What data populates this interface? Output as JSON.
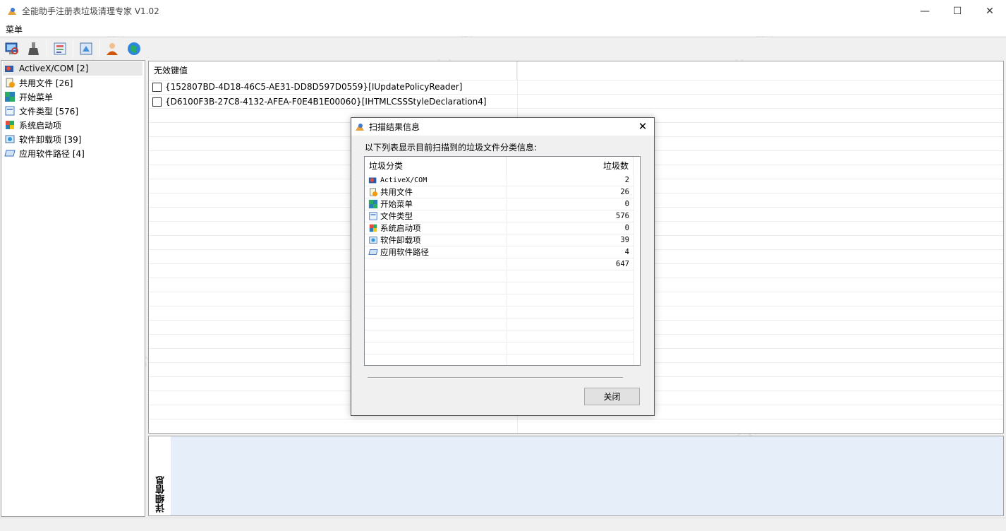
{
  "window": {
    "title": "全能助手注册表垃圾清理专家 V1.02",
    "minimize_glyph": "—",
    "maximize_glyph": "☐",
    "close_glyph": "✕"
  },
  "menu": {
    "items": [
      "菜单"
    ]
  },
  "toolbar": {
    "buttons": [
      "scan-computer-icon",
      "cleanup-brush-icon",
      "registry-icon",
      "backup-icon",
      "user-icon",
      "help-globe-icon"
    ]
  },
  "tree": {
    "items": [
      {
        "label": "ActiveX/COM [2]",
        "icon": "activex-icon"
      },
      {
        "label": "共用文件 [26]",
        "icon": "shared-files-icon"
      },
      {
        "label": "开始菜单",
        "icon": "start-menu-icon"
      },
      {
        "label": "文件类型 [576]",
        "icon": "file-type-icon"
      },
      {
        "label": "系统启动项",
        "icon": "startup-icon"
      },
      {
        "label": "软件卸载项 [39]",
        "icon": "uninstall-icon"
      },
      {
        "label": "应用软件路径 [4]",
        "icon": "app-path-icon"
      }
    ],
    "selected_index": 0
  },
  "list": {
    "header": "无效键值",
    "rows": [
      "{152807BD-4D18-46C5-AE31-DD8D597D0559}[IUpdatePolicyReader]",
      "{D6100F3B-27C8-4132-AFEA-F0E4B1E00060}[IHTMLCSSStyleDeclaration4]"
    ]
  },
  "detail": {
    "label": "详细信息"
  },
  "dialog": {
    "title": "扫描结果信息",
    "description": "以下列表显示目前扫描到的垃圾文件分类信息:",
    "col_category": "垃圾分类",
    "col_count": "垃圾数",
    "rows": [
      {
        "name": "ActiveX/COM",
        "count": "2"
      },
      {
        "name": "共用文件",
        "count": "26"
      },
      {
        "name": "开始菜单",
        "count": "0"
      },
      {
        "name": "文件类型",
        "count": "576"
      },
      {
        "name": "系统启动项",
        "count": "0"
      },
      {
        "name": "软件卸载项",
        "count": "39"
      },
      {
        "name": "应用软件路径",
        "count": "4"
      }
    ],
    "total": "647",
    "close_button": "关闭",
    "close_glyph": "✕"
  },
  "watermark": "WEIDOWN.COM"
}
